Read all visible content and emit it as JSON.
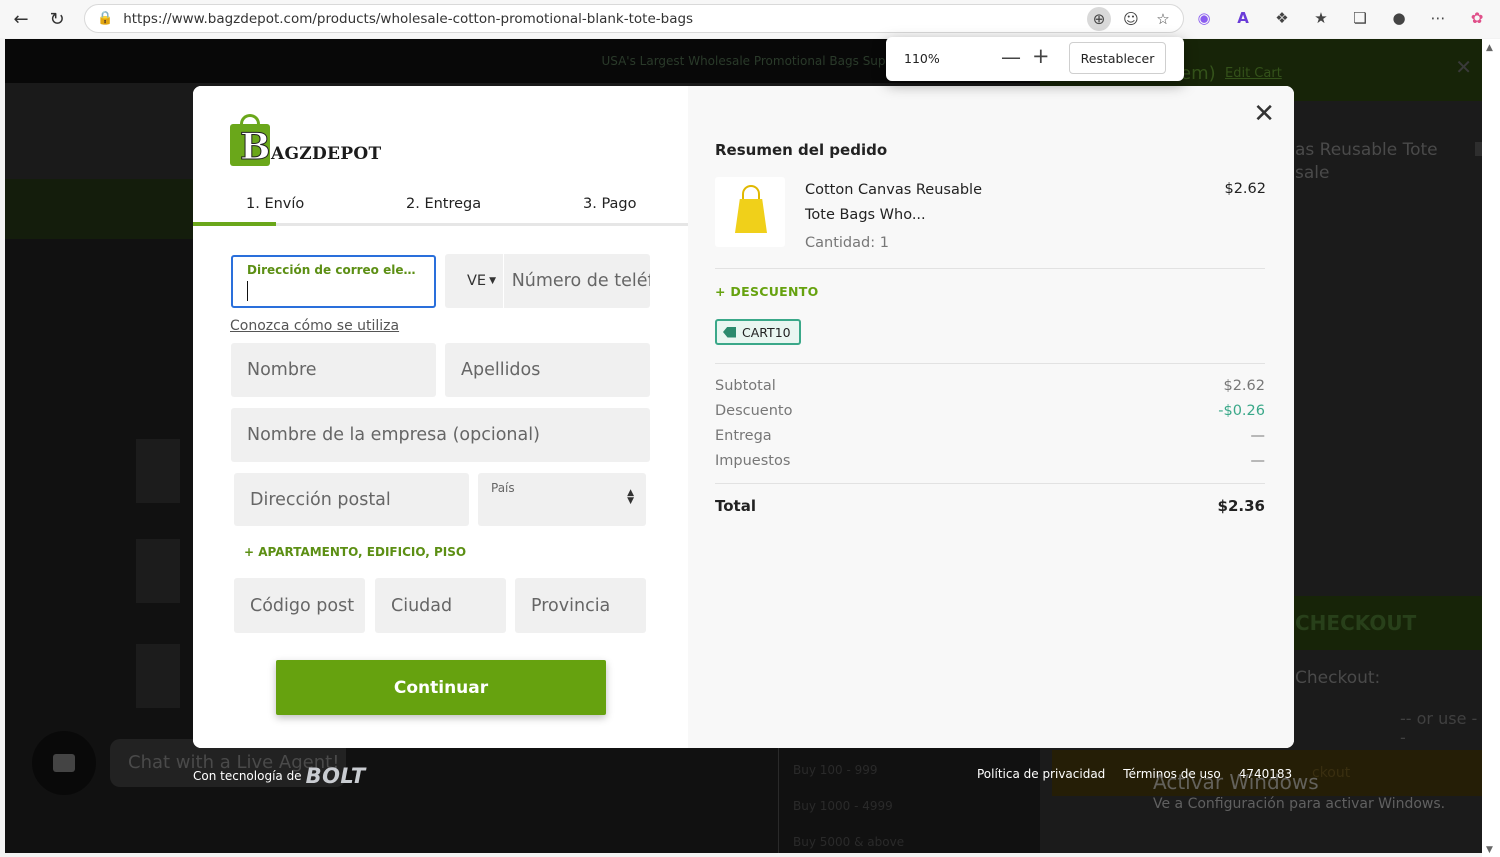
{
  "browser": {
    "url": "https://www.bagzdepot.com/products/wholesale-cotton-promotional-blank-tote-bags",
    "zoom_level": "110%",
    "zoom_reset_label": "Restablecer"
  },
  "background_page": {
    "banner_text": "USA's Largest Wholesale Promotional Bags Sup",
    "cart_items_label": "em)",
    "cart_edit_label": "Edit Cart",
    "cart_item_name": "as Reusable Tote sale",
    "cart_checkout_label": "CHECKOUT",
    "express_checkout_label": "Checkout:",
    "or_use_label": "-- or use --",
    "paypal_label": "ckout",
    "price_tiers": [
      "Buy 100 - 999",
      "Buy 1000 - 4999",
      "Buy 5000 & above"
    ],
    "chat_label": "Chat with a Live Agent!",
    "watermark_title": "Activar Windows",
    "watermark_subtitle": "Ve a Configuración para activar Windows."
  },
  "modal": {
    "logo_text": "AGZDEPOT",
    "tabs": [
      {
        "label": "1. Envío",
        "active": true
      },
      {
        "label": "2. Entrega",
        "active": false
      },
      {
        "label": "3. Pago",
        "active": false
      }
    ],
    "form": {
      "email_label": "Dirección de correo electrónico",
      "email_value": "",
      "phone_country": "VE",
      "phone_placeholder": "Número de teléfono",
      "learn_link": "Conozca cómo se utiliza",
      "first_name_placeholder": "Nombre",
      "last_name_placeholder": "Apellidos",
      "company_placeholder": "Nombre de la empresa (opcional)",
      "address_placeholder": "Dirección postal",
      "country_label": "País",
      "apartment_link": "+ APARTAMENTO, EDIFICIO, PISO",
      "postal_placeholder": "Código post",
      "city_placeholder": "Ciudad",
      "province_placeholder": "Provincia",
      "continue_label": "Continuar"
    },
    "summary": {
      "title": "Resumen del pedido",
      "product_name": "Cotton Canvas Reusable Tote Bags Who...",
      "product_qty": "Cantidad: 1",
      "product_price": "$2.62",
      "discount_link": "+ DESCUENTO",
      "coupon_code": "CART10",
      "rows": [
        {
          "label": "Subtotal",
          "value": "$2.62"
        },
        {
          "label": "Descuento",
          "value": "-$0.26"
        },
        {
          "label": "Entrega",
          "value": "—"
        },
        {
          "label": "Impuestos",
          "value": "—"
        }
      ],
      "total_label": "Total",
      "total_value": "$2.36"
    },
    "footer": {
      "powered_by": "Con tecnología de",
      "powered_brand": "BOLT",
      "privacy": "Política de privacidad",
      "terms": "Términos de uso",
      "id": "4740183"
    }
  },
  "colors": {
    "accent_green": "#66a20f",
    "focus_blue": "#2a6fdb",
    "discount_teal": "#3aa889"
  }
}
